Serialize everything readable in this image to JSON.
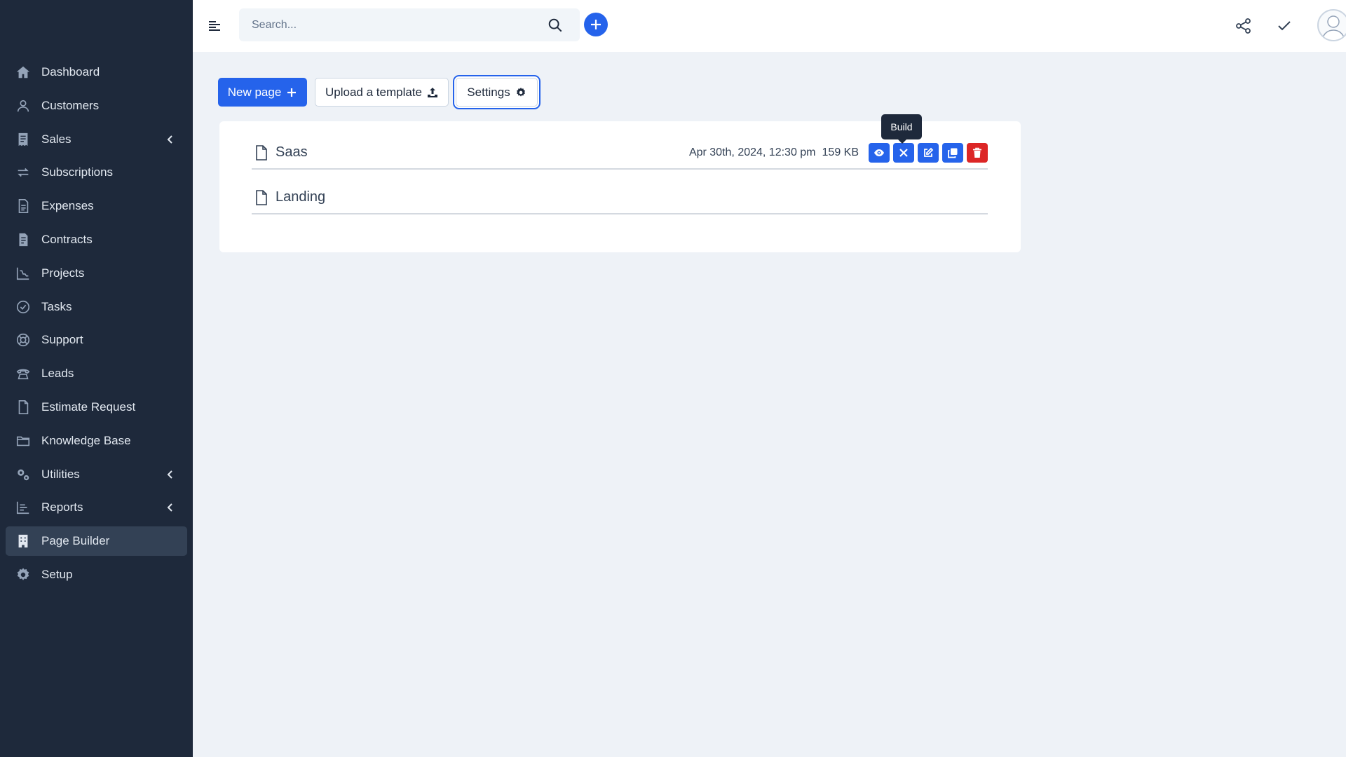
{
  "sidebar": {
    "items": [
      {
        "label": "Dashboard",
        "icon": "home-icon"
      },
      {
        "label": "Customers",
        "icon": "user-icon"
      },
      {
        "label": "Sales",
        "icon": "receipt-icon",
        "has_submenu": true
      },
      {
        "label": "Subscriptions",
        "icon": "refresh-icon"
      },
      {
        "label": "Expenses",
        "icon": "document-text-icon"
      },
      {
        "label": "Contracts",
        "icon": "contract-icon"
      },
      {
        "label": "Projects",
        "icon": "chart-line-icon"
      },
      {
        "label": "Tasks",
        "icon": "check-circle-icon"
      },
      {
        "label": "Support",
        "icon": "lifebuoy-icon"
      },
      {
        "label": "Leads",
        "icon": "phone-icon"
      },
      {
        "label": "Estimate Request",
        "icon": "document-icon"
      },
      {
        "label": "Knowledge Base",
        "icon": "folder-icon"
      },
      {
        "label": "Utilities",
        "icon": "gears-icon",
        "has_submenu": true
      },
      {
        "label": "Reports",
        "icon": "chart-bar-icon",
        "has_submenu": true
      },
      {
        "label": "Page Builder",
        "icon": "building-icon",
        "active": true
      },
      {
        "label": "Setup",
        "icon": "gear-icon"
      }
    ]
  },
  "header": {
    "search_placeholder": "Search..."
  },
  "toolbar": {
    "new_page_label": "New page",
    "upload_label": "Upload a template",
    "settings_label": "Settings"
  },
  "pages": [
    {
      "name": "Saas",
      "date": "Apr 30th, 2024, 12:30 pm",
      "size": "159 KB"
    },
    {
      "name": "Landing"
    }
  ],
  "tooltip": {
    "text": "Build"
  },
  "colors": {
    "sidebar_bg": "#1e293b",
    "accent": "#2563eb",
    "danger": "#dc2626",
    "page_bg": "#eef2f7"
  }
}
